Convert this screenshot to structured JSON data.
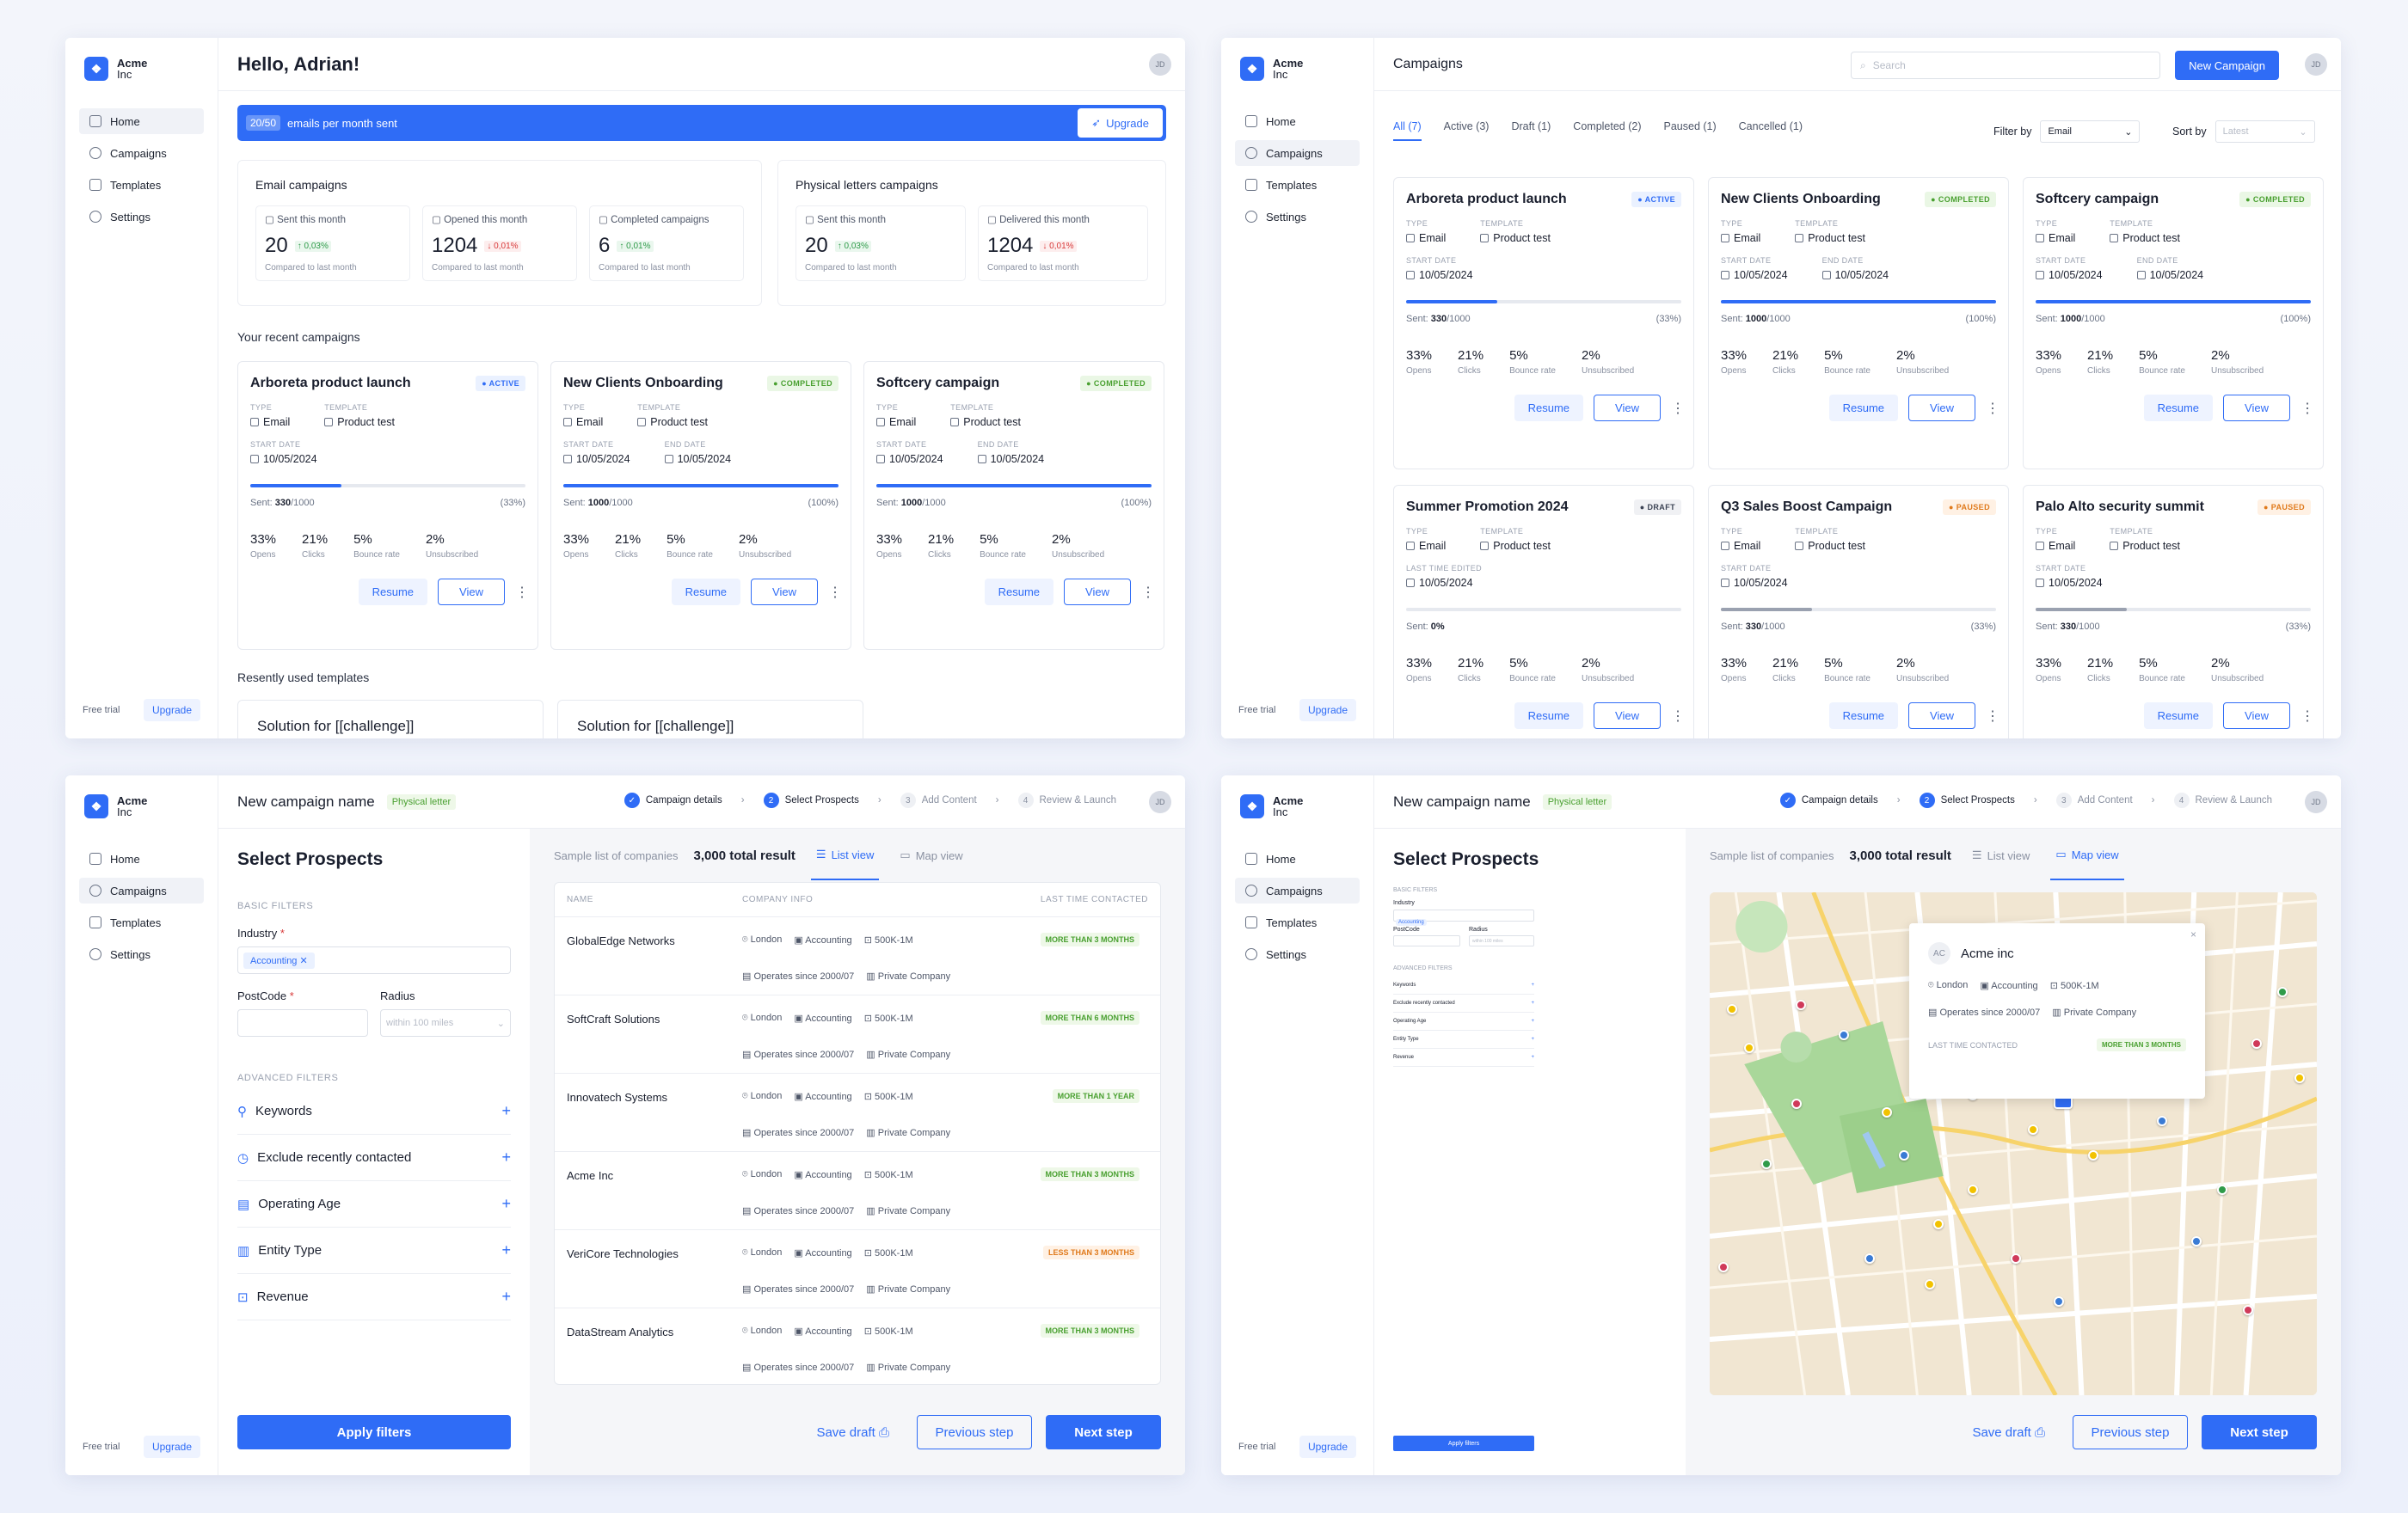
{
  "brand": {
    "name": "Acme",
    "sub": "Inc"
  },
  "nav": [
    "Home",
    "Campaigns",
    "Templates",
    "Settings"
  ],
  "sidebar_footer": {
    "trial": "Free trial",
    "upgrade": "Upgrade"
  },
  "avatar": "JD",
  "dashboard": {
    "greeting": "Hello, Adrian!",
    "banner": {
      "count": "20/50",
      "text": "emails per month sent",
      "upgrade": "Upgrade"
    },
    "email_box": {
      "title": "Email campaigns",
      "stats": [
        {
          "label": "Sent this month",
          "value": "20",
          "delta": "0,03%",
          "dir": "up",
          "note": "Compared to last month"
        },
        {
          "label": "Opened this month",
          "value": "1204",
          "delta": "0,01%",
          "dir": "dn",
          "note": "Compared to last month"
        },
        {
          "label": "Completed campaigns",
          "value": "6",
          "delta": "0,01%",
          "dir": "up",
          "note": "Compared to last month"
        }
      ]
    },
    "letters_box": {
      "title": "Physical letters campaigns",
      "stats": [
        {
          "label": "Sent this month",
          "value": "20",
          "delta": "0,03%",
          "dir": "up",
          "note": "Compared to last month"
        },
        {
          "label": "Delivered this month",
          "value": "1204",
          "delta": "0,01%",
          "dir": "dn",
          "note": "Compared to last month"
        }
      ]
    },
    "recent_title": "Your recent campaigns",
    "templates_title": "Resently used templates",
    "templates": [
      "Solution for [[challenge]]",
      "Solution for [[challenge]]"
    ]
  },
  "campaign_labels": {
    "type": "TYPE",
    "template": "TEMPLATE",
    "start": "START DATE",
    "end": "END DATE",
    "edited": "LAST TIME EDITED",
    "sent": "Sent:",
    "opens": "Opens",
    "clicks": "Clicks",
    "bounce": "Bounce rate",
    "unsub": "Unsubscribed",
    "resume": "Resume",
    "view": "View"
  },
  "campaigns": [
    {
      "name": "Arboreta product launch",
      "status": "ACTIVE",
      "cls": "b-active",
      "type": "Email",
      "template": "Product test",
      "date1_label": "START DATE",
      "date1": "10/05/2024",
      "date2": "",
      "sent": "330",
      "total": "/1000",
      "pct": "(33%)",
      "progress": 0.33,
      "opens": "33%",
      "clicks": "21%",
      "bounce": "5%",
      "unsub": "2%"
    },
    {
      "name": "New Clients Onboarding",
      "status": "COMPLETED",
      "cls": "b-completed",
      "type": "Email",
      "template": "Product test",
      "date1_label": "START DATE",
      "date1": "10/05/2024",
      "date2": "10/05/2024",
      "sent": "1000",
      "total": "/1000",
      "pct": "(100%)",
      "progress": 1,
      "opens": "33%",
      "clicks": "21%",
      "bounce": "5%",
      "unsub": "2%"
    },
    {
      "name": "Softcery campaign",
      "status": "COMPLETED",
      "cls": "b-completed",
      "type": "Email",
      "template": "Product test",
      "date1_label": "START DATE",
      "date1": "10/05/2024",
      "date2": "10/05/2024",
      "sent": "1000",
      "total": "/1000",
      "pct": "(100%)",
      "progress": 1,
      "opens": "33%",
      "clicks": "21%",
      "bounce": "5%",
      "unsub": "2%"
    },
    {
      "name": "Summer Promotion 2024",
      "status": "DRAFT",
      "cls": "b-draft",
      "type": "Email",
      "template": "Product test",
      "date1_label": "LAST TIME EDITED",
      "date1": "10/05/2024",
      "date2": "",
      "sent": "0%",
      "total": "",
      "pct": "",
      "progress": 0,
      "opens": "33%",
      "clicks": "21%",
      "bounce": "5%",
      "unsub": "2%"
    },
    {
      "name": "Q3 Sales Boost Campaign",
      "status": "PAUSED",
      "cls": "b-paused",
      "type": "Email",
      "template": "Product test",
      "date1_label": "START DATE",
      "date1": "10/05/2024",
      "date2": "",
      "sent": "330",
      "total": "/1000",
      "pct": "(33%)",
      "progress": 0.33,
      "opens": "33%",
      "clicks": "21%",
      "bounce": "5%",
      "unsub": "2%"
    },
    {
      "name": "Palo Alto security summit",
      "status": "PAUSED",
      "cls": "b-paused",
      "type": "Email",
      "template": "Product test",
      "date1_label": "START DATE",
      "date1": "10/05/2024",
      "date2": "",
      "sent": "330",
      "total": "/1000",
      "pct": "(33%)",
      "progress": 0.33,
      "opens": "33%",
      "clicks": "21%",
      "bounce": "5%",
      "unsub": "2%"
    }
  ],
  "campaigns_page": {
    "title": "Campaigns",
    "search_placeholder": "Search",
    "new_btn": "New Campaign",
    "tabs": [
      "All (7)",
      "Active (3)",
      "Draft (1)",
      "Completed (2)",
      "Paused (1)",
      "Cancelled (1)"
    ],
    "filter_label": "Filter by",
    "filter_value": "Email",
    "sort_label": "Sort by",
    "sort_placeholder": "Latest"
  },
  "wizard": {
    "name": "New campaign name",
    "tag": "Physical letter",
    "steps": [
      {
        "n": "1",
        "label": "Campaign details"
      },
      {
        "n": "2",
        "label": "Select Prospects"
      },
      {
        "n": "3",
        "label": "Add Content"
      },
      {
        "n": "4",
        "label": "Review & Launch"
      }
    ],
    "title": "Select Prospects",
    "basic": "BASIC FILTERS",
    "industry": "Industry",
    "industry_chip": "Accounting",
    "postcode": "PostCode",
    "radius": "Radius",
    "radius_ph": "within 100 miles",
    "advanced": "ADVANCED FILTERS",
    "adv": [
      "Keywords",
      "Exclude recently contacted",
      "Operating Age",
      "Entity Type",
      "Revenue"
    ],
    "apply": "Apply filters",
    "sample": "Sample list of companies",
    "total": "3,000 total result",
    "list_view": "List view",
    "map_view": "Map view",
    "cols": [
      "NAME",
      "COMPANY INFO",
      "LAST TIME CONTACTED"
    ],
    "save": "Save draft",
    "prev": "Previous step",
    "next": "Next step"
  },
  "companies": [
    {
      "name": "GlobalEdge Networks",
      "city": "London",
      "industry": "Accounting",
      "size": "500K-1M",
      "since": "Operates since 2000/07",
      "kind": "Private Company",
      "tag": "MORE THAN 3 MONTHS",
      "tcls": "g"
    },
    {
      "name": "SoftCraft Solutions",
      "city": "London",
      "industry": "Accounting",
      "size": "500K-1M",
      "since": "Operates since 2000/07",
      "kind": "Private Company",
      "tag": "MORE THAN 6 MONTHS",
      "tcls": "g"
    },
    {
      "name": "Innovatech Systems",
      "city": "London",
      "industry": "Accounting",
      "size": "500K-1M",
      "since": "Operates since 2000/07",
      "kind": "Private Company",
      "tag": "MORE THAN 1 YEAR",
      "tcls": "g"
    },
    {
      "name": "Acme Inc",
      "city": "London",
      "industry": "Accounting",
      "size": "500K-1M",
      "since": "Operates since 2000/07",
      "kind": "Private Company",
      "tag": "MORE THAN 3 MONTHS",
      "tcls": "g"
    },
    {
      "name": "VeriCore Technologies",
      "city": "London",
      "industry": "Accounting",
      "size": "500K-1M",
      "since": "Operates since 2000/07",
      "kind": "Private Company",
      "tag": "LESS THAN 3 MONTHS",
      "tcls": "o"
    },
    {
      "name": "DataStream Analytics",
      "city": "London",
      "industry": "Accounting",
      "size": "500K-1M",
      "since": "Operates since 2000/07",
      "kind": "Private Company",
      "tag": "MORE THAN 3 MONTHS",
      "tcls": "g"
    }
  ],
  "map_popup": {
    "initials": "AC",
    "name": "Acme inc",
    "city": "London",
    "industry": "Accounting",
    "size": "500K-1M",
    "since": "Operates since 2000/07",
    "kind": "Private Company",
    "last_label": "LAST TIME CONTACTED",
    "last": "MORE THAN 3 MONTHS"
  },
  "colors": {
    "accent": "#2f6cf6",
    "success": "#49a030",
    "warning": "#e07a1c",
    "danger": "#d83a3a"
  }
}
